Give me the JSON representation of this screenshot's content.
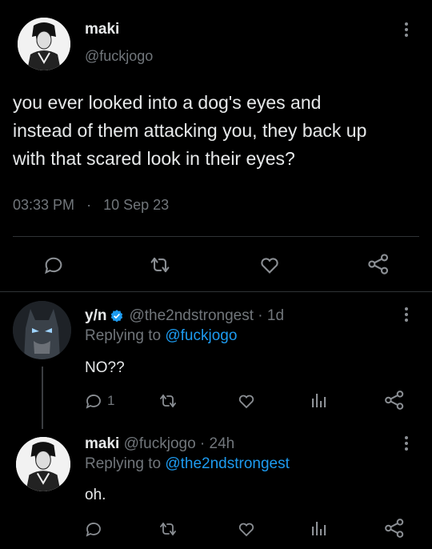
{
  "main_tweet": {
    "display_name": "maki",
    "handle": "@fuckjogo",
    "text_lines": [
      "you ever looked into a dog's eyes and",
      "instead of them attacking you, they back up",
      "with that scared look in their eyes?"
    ],
    "time": "03:33 PM",
    "separator": "·",
    "date": "10 Sep 23",
    "icons": [
      "reply-icon",
      "retweet-icon",
      "like-icon",
      "share-icon"
    ]
  },
  "reply1": {
    "display_name": "y/n",
    "verified": true,
    "handle_time": "@the2ndstrongest · 1d",
    "replying_prefix": "Replying to",
    "replying_to": "@fuckjogo",
    "text": "NO??",
    "reply_count": "1",
    "icons": [
      "reply-icon",
      "retweet-icon",
      "like-icon",
      "analytics-icon",
      "share-icon"
    ]
  },
  "reply2": {
    "display_name": "maki",
    "handle_time": "@fuckjogo · 24h",
    "replying_prefix": "Replying to",
    "replying_to": "@the2ndstrongest",
    "text": "oh.",
    "icons": [
      "reply-icon",
      "retweet-icon",
      "like-icon",
      "analytics-icon",
      "share-icon"
    ]
  },
  "colors": {
    "background": "#000000",
    "text": "#e7e9ea",
    "muted": "#71767b",
    "link": "#1d9bf0",
    "verified": "#1d9bf0"
  }
}
